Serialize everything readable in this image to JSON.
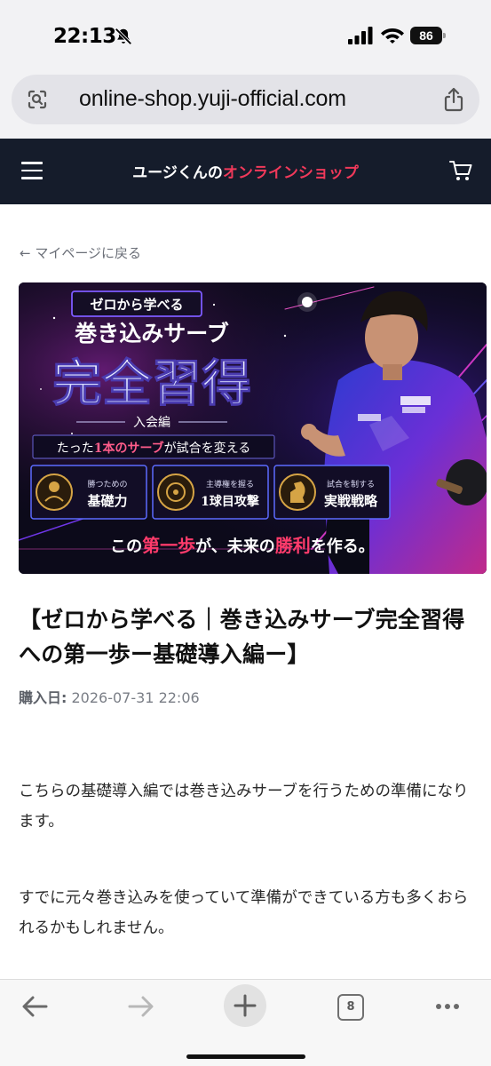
{
  "status_bar": {
    "time": "22:13",
    "battery": "86"
  },
  "browser": {
    "url": "online-shop.yuji-official.com",
    "tab_count": "8"
  },
  "header": {
    "title_main": "ユージくんの",
    "title_accent": "オンラインショップ",
    "accent_color": "#f0395a",
    "background_color": "#151c2b"
  },
  "back_link": "← マイページに戻る",
  "hero": {
    "tag": "ゼロから学べる",
    "subtitle": "巻き込みサーブ",
    "main": "完全習得",
    "edition": "入会編",
    "tagline_pre": "たった",
    "tagline_accent": "1本のサーブ",
    "tagline_post": "が試合を変える",
    "features": [
      {
        "small": "勝つための",
        "big": "基礎力"
      },
      {
        "small": "主導権を握る",
        "big": "1球目攻撃"
      },
      {
        "small": "試合を制する",
        "big": "実戦戦略"
      }
    ],
    "footer_pre": "この",
    "footer_accent1": "第一歩",
    "footer_mid": "が、未来の",
    "footer_accent2": "勝利",
    "footer_post": "を作る。"
  },
  "product": {
    "title": "【ゼロから学べる｜巻き込みサーブ完全習得への第一歩ー基礎導入編ー】",
    "date_label": "購入日:",
    "date_value": "2026-07-31 22:06"
  },
  "body": {
    "para1": "こちらの基礎導入編では巻き込みサーブを行うための準備になります。",
    "para2": "すでに元々巻き込みを使っていて準備ができている方も多くおられるかもしれません。"
  }
}
